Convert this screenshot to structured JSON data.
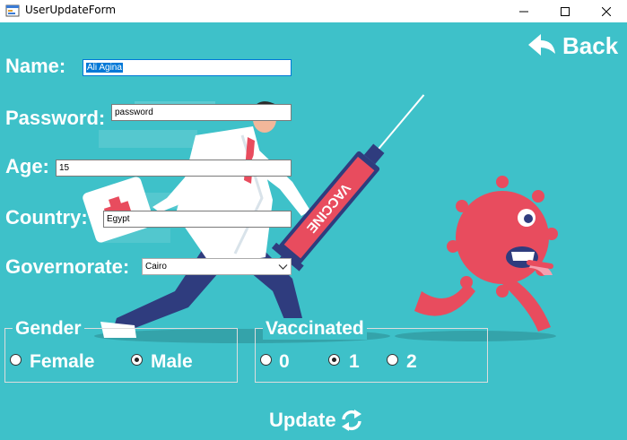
{
  "window": {
    "title": "UserUpdateForm",
    "icon": "app-form-icon"
  },
  "nav": {
    "back_label": "Back",
    "back_icon": "curved-arrow-left-icon"
  },
  "form": {
    "name_label": "Name:",
    "name_value": "Ali Agina",
    "password_label": "Password:",
    "password_value": "password",
    "age_label": "Age:",
    "age_value": "15",
    "country_label": "Country:",
    "country_value": "Egypt",
    "governorate_label": "Governorate:",
    "governorate_value": "Cairo"
  },
  "gender": {
    "title": "Gender",
    "options": [
      "Female",
      "Male"
    ],
    "selected": "Male"
  },
  "vaccinated": {
    "title": "Vaccinated",
    "options": [
      "0",
      "1",
      "2"
    ],
    "selected": "1"
  },
  "actions": {
    "update_label": "Update",
    "update_icon": "refresh-arrows-icon"
  },
  "illustration": {
    "syringe_text": "VACCINE"
  },
  "colors": {
    "background": "#3ec1c9",
    "virus": "#e84c5e",
    "syringe_body": "#e84c5e",
    "coat": "#ffffff",
    "pants": "#2f3c7e"
  }
}
